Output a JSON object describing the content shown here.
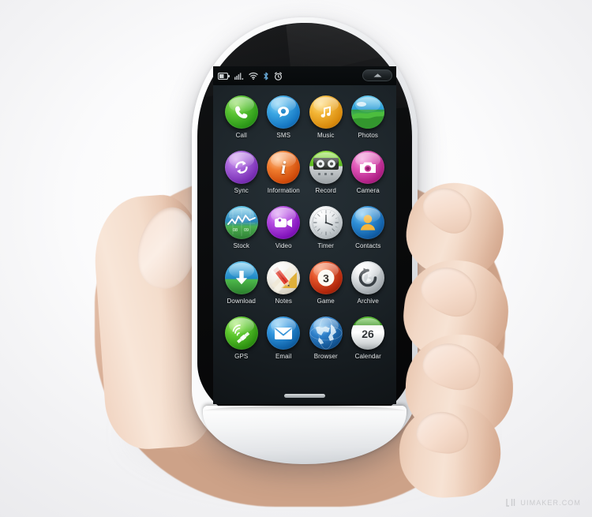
{
  "scene": {
    "title": "Smartphone held in hand — home screen mockup",
    "background_color": "#f2f2f4",
    "device_shell_color": "#ffffff",
    "screen_background_color": "#1e262b"
  },
  "statusbar": {
    "icons": [
      {
        "name": "battery-icon",
        "label": "Battery"
      },
      {
        "name": "signal-icon",
        "label": "Signal"
      },
      {
        "name": "wifi-icon",
        "label": "Wi-Fi"
      },
      {
        "name": "bluetooth-icon",
        "label": "Bluetooth"
      },
      {
        "name": "alarm-icon",
        "label": "Alarm"
      }
    ],
    "pullup_tab": {
      "name": "chevron-up-icon",
      "label": "Expand"
    }
  },
  "grid": {
    "columns": 4,
    "rows": 5,
    "apps": [
      {
        "label": "Call",
        "icon": "phone-icon",
        "color": "#3aa823"
      },
      {
        "label": "SMS",
        "icon": "chat-icon",
        "color": "#1f8ed8"
      },
      {
        "label": "Music",
        "icon": "note-icon",
        "color": "#e09a1c"
      },
      {
        "label": "Photos",
        "icon": "landscape-icon",
        "color": "#2f9ed4"
      },
      {
        "label": "Sync",
        "icon": "refresh-icon",
        "color": "#8d45c7"
      },
      {
        "label": "Information",
        "icon": "info-icon",
        "color": "#e35b12"
      },
      {
        "label": "Record",
        "icon": "cassette-icon",
        "color": "#63b320"
      },
      {
        "label": "Camera",
        "icon": "camera-icon",
        "color": "#d03ca0"
      },
      {
        "label": "Stock",
        "icon": "chart-icon",
        "color": "#1f7fb8"
      },
      {
        "label": "Video",
        "icon": "camcorder-icon",
        "color": "#9b2fd0"
      },
      {
        "label": "Timer",
        "icon": "clock-icon",
        "color": "#c9ccd0"
      },
      {
        "label": "Contacts",
        "icon": "person-icon",
        "color": "#1a74c4"
      },
      {
        "label": "Download",
        "icon": "download-icon",
        "color": "#2090cc"
      },
      {
        "label": "Notes",
        "icon": "pencil-icon",
        "color": "#e8e4dc"
      },
      {
        "label": "Game",
        "icon": "billiard-icon",
        "color": "#d23b1c"
      },
      {
        "label": "Archive",
        "icon": "restore-icon",
        "color": "#b9bcc0"
      },
      {
        "label": "GPS",
        "icon": "satellite-icon",
        "color": "#44ad1f"
      },
      {
        "label": "Email",
        "icon": "envelope-icon",
        "color": "#1f86d4"
      },
      {
        "label": "Browser",
        "icon": "globe-icon",
        "color": "#1c6fbe"
      },
      {
        "label": "Calendar",
        "icon": "calendar-icon",
        "color": "#ececec"
      }
    ]
  },
  "icon_text": {
    "stock_years": [
      "08",
      "09"
    ],
    "game_number": "3",
    "calendar_day": "26",
    "information_letter": "i"
  },
  "device": {
    "home_key": "flower-logo-icon",
    "home_bar": "home-indicator"
  },
  "watermark": {
    "logo": "uimaker-logo-icon",
    "text": "UIMAKER.COM"
  }
}
